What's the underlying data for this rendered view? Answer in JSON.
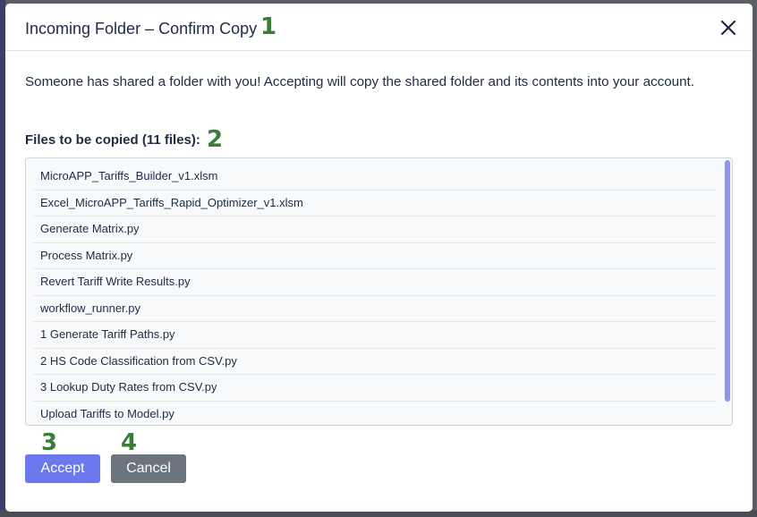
{
  "dialog": {
    "title": "Incoming Folder – Confirm Copy",
    "close_icon": "close-icon",
    "intro": "Someone has shared a folder with you! Accepting will copy the shared folder and its contents into your account.",
    "files_heading": "Files to be copied (11 files):",
    "files": [
      "MicroAPP_Tariffs_Builder_v1.xlsm",
      "Excel_MicroAPP_Tariffs_Rapid_Optimizer_v1.xlsm",
      "Generate Matrix.py",
      "Process Matrix.py",
      "Revert Tariff Write Results.py",
      "workflow_runner.py",
      "1 Generate Tariff Paths.py",
      "2 HS Code Classification from CSV.py",
      "3 Lookup Duty Rates from CSV.py",
      "Upload Tariffs to Model.py"
    ],
    "accept_label": "Accept",
    "cancel_label": "Cancel"
  },
  "markers": [
    "1",
    "2",
    "3",
    "4"
  ],
  "colors": {
    "accept": "#6b78ee",
    "cancel": "#6c757d",
    "marker": "#3a7d3a",
    "scrollbar": "#8f96e8"
  }
}
